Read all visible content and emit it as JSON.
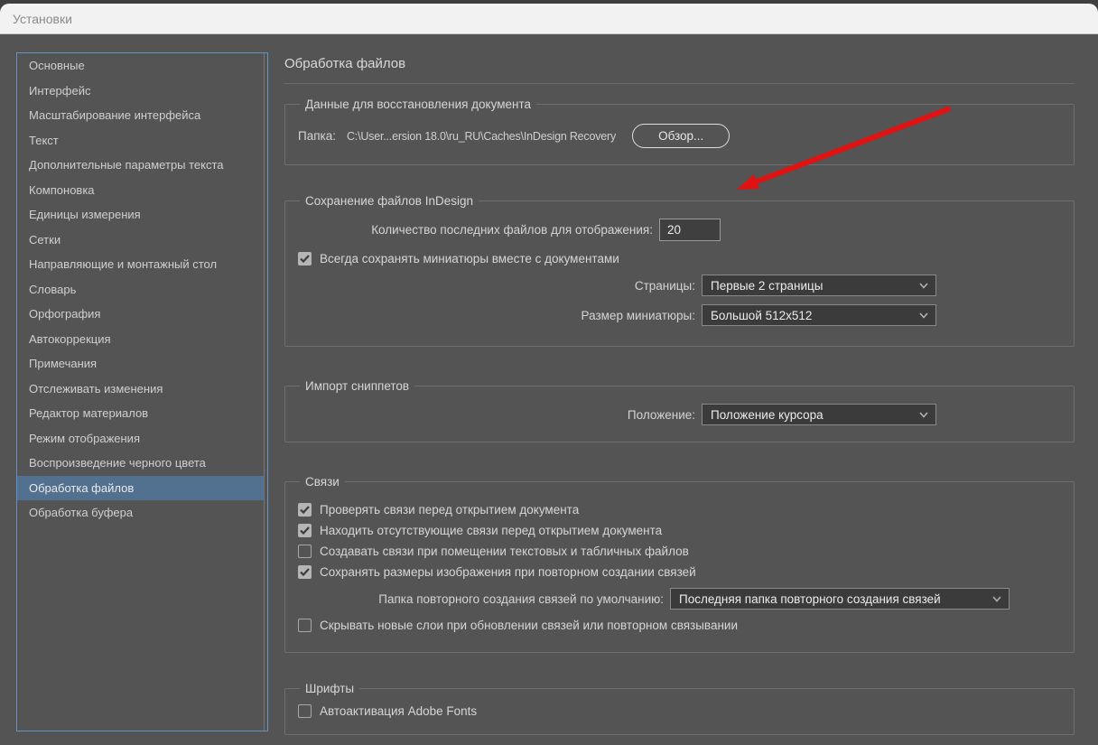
{
  "window": {
    "title": "Установки"
  },
  "sidebar": {
    "items": [
      {
        "label": "Основные",
        "selected": false
      },
      {
        "label": "Интерфейс",
        "selected": false
      },
      {
        "label": "Масштабирование интерфейса",
        "selected": false
      },
      {
        "label": "Текст",
        "selected": false
      },
      {
        "label": "Дополнительные параметры текста",
        "selected": false
      },
      {
        "label": "Компоновка",
        "selected": false
      },
      {
        "label": "Единицы измерения",
        "selected": false
      },
      {
        "label": "Сетки",
        "selected": false
      },
      {
        "label": "Направляющие и монтажный стол",
        "selected": false
      },
      {
        "label": "Словарь",
        "selected": false
      },
      {
        "label": "Орфография",
        "selected": false
      },
      {
        "label": "Автокоррекция",
        "selected": false
      },
      {
        "label": "Примечания",
        "selected": false
      },
      {
        "label": "Отслеживать изменения",
        "selected": false
      },
      {
        "label": "Редактор материалов",
        "selected": false
      },
      {
        "label": "Режим отображения",
        "selected": false
      },
      {
        "label": "Воспроизведение черного цвета",
        "selected": false
      },
      {
        "label": "Обработка файлов",
        "selected": true
      },
      {
        "label": "Обработка буфера",
        "selected": false
      }
    ]
  },
  "main": {
    "title": "Обработка файлов",
    "recovery": {
      "legend": "Данные для восстановления документа",
      "folder_label": "Папка:",
      "folder_path": "C:\\User...ersion 18.0\\ru_RU\\Caches\\InDesign Recovery",
      "browse_label": "Обзор..."
    },
    "saving": {
      "legend": "Сохранение файлов InDesign",
      "recent_files_label": "Количество последних файлов для отображения:",
      "recent_files_value": "20",
      "thumbnails": {
        "label": "Всегда сохранять миниатюры вместе с документами",
        "checked": true
      },
      "pages_label": "Страницы:",
      "pages_value": "Первые 2 страницы",
      "thumb_size_label": "Размер миниатюры:",
      "thumb_size_value": "Большой 512x512"
    },
    "snippets": {
      "legend": "Импорт сниппетов",
      "position_label": "Положение:",
      "position_value": "Положение курсора"
    },
    "links": {
      "legend": "Связи",
      "checkboxes": [
        {
          "label": "Проверять связи перед открытием документа",
          "checked": true
        },
        {
          "label": "Находить отсутствующие связи перед открытием документа",
          "checked": true
        },
        {
          "label": "Создавать связи при помещении текстовых и табличных файлов",
          "checked": false
        },
        {
          "label": "Сохранять размеры изображения при повторном создании связей",
          "checked": true
        }
      ],
      "relink_folder_label": "Папка повторного создания связей по умолчанию:",
      "relink_folder_value": "Последняя папка повторного создания связей",
      "hide_layers": {
        "label": "Скрывать новые слои при обновлении связей или повторном связывании",
        "checked": false
      }
    },
    "fonts": {
      "legend": "Шрифты",
      "auto_activate": {
        "label": "Автоактивация Adobe Fonts",
        "checked": false
      }
    }
  },
  "annotation": {
    "arrow_color": "#e01212"
  },
  "colors": {
    "dialog_bg": "#545454",
    "titlebar_bg": "#f2f2f2",
    "sidebar_border": "#6494c4",
    "selected_item_bg": "#52708f",
    "field_bg": "#3b3b3b",
    "text": "#d6d6d6"
  }
}
